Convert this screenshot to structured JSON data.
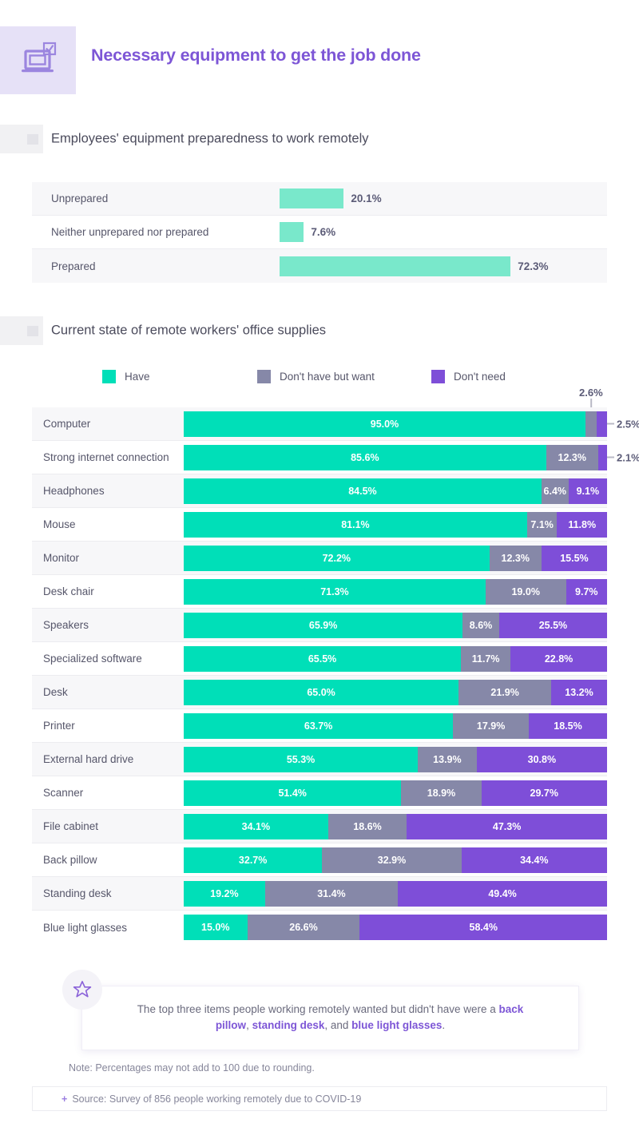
{
  "header": {
    "title": "Necessary equipment to get the job done",
    "icon": "laptop-check-icon",
    "icon_bg": "#e6e1f7",
    "title_color": "#7d56d6"
  },
  "colors": {
    "have": "#00dfb8",
    "have_light": "#79e8cb",
    "dont_have_but_want": "#8688a8",
    "dont_need": "#7e4ed8",
    "row_alt": "#f7f7f9",
    "text": "#56566a",
    "value_text": "#5b5b77"
  },
  "section1": {
    "marker": "section-marker",
    "title": "Employees' equipment preparedness to work remotely"
  },
  "section2": {
    "marker": "section-marker",
    "title": "Current state of remote workers' office supplies"
  },
  "legend": [
    {
      "label": "Have",
      "color": "#00dfb8"
    },
    {
      "label": "Don't have but want",
      "color": "#8688a8"
    },
    {
      "label": "Don't need",
      "color": "#7e4ed8"
    }
  ],
  "highlight": {
    "icon": "star-icon",
    "text_part1": "The top three items people working remotely wanted but didn't have were a ",
    "strong1": "back pillow",
    "text_part2": ", ",
    "strong2": "standing desk",
    "text_part3": ", and ",
    "strong3": "blue light glasses",
    "text_part4": "."
  },
  "footer": {
    "note": "Note: Percentages may not add to 100 due to rounding.",
    "source_plus": "+",
    "source": "Source: Survey of 856 people working remotely due to COVID-19"
  },
  "chart_data": [
    {
      "type": "bar",
      "title": "Employees' equipment preparedness to work remotely",
      "xlabel": "",
      "ylabel": "",
      "xlim": [
        0,
        100
      ],
      "grid": false,
      "legend_position": "none",
      "categories": [
        "Unprepared",
        "Neither unprepared nor prepared",
        "Prepared"
      ],
      "values": [
        20.1,
        7.6,
        72.3
      ],
      "value_labels": [
        "20.1%",
        "7.6%",
        "72.3%"
      ],
      "bar_color": "#79e8cb"
    },
    {
      "type": "bar",
      "subtype": "stacked-horizontal-100",
      "title": "Current state of remote workers' office supplies",
      "xlabel": "",
      "ylabel": "",
      "xlim": [
        0,
        100
      ],
      "grid": false,
      "legend_position": "top",
      "categories": [
        "Computer",
        "Strong internet connection",
        "Headphones",
        "Mouse",
        "Monitor",
        "Desk chair",
        "Speakers",
        "Specialized software",
        "Desk",
        "Printer",
        "External hard drive",
        "Scanner",
        "File cabinet",
        "Back pillow",
        "Standing desk",
        "Blue light glasses"
      ],
      "series": [
        {
          "name": "Have",
          "color": "#00dfb8",
          "values": [
            95.0,
            85.6,
            84.5,
            81.1,
            72.2,
            71.3,
            65.9,
            65.5,
            65.0,
            63.7,
            55.3,
            51.4,
            34.1,
            32.7,
            19.2,
            15.0
          ]
        },
        {
          "name": "Don't have but want",
          "color": "#8688a8",
          "values": [
            2.6,
            12.3,
            6.4,
            7.1,
            12.3,
            19.0,
            8.6,
            11.7,
            21.9,
            17.9,
            13.9,
            18.9,
            18.6,
            32.9,
            31.4,
            26.6
          ]
        },
        {
          "name": "Don't need",
          "color": "#7e4ed8",
          "values": [
            2.5,
            2.1,
            9.1,
            11.8,
            15.5,
            9.7,
            25.5,
            22.8,
            13.2,
            18.5,
            30.8,
            29.7,
            47.3,
            34.4,
            49.4,
            58.4
          ]
        }
      ]
    }
  ],
  "simple_rows": [
    {
      "label": "Unprepared",
      "value": 20.1,
      "value_label": "20.1%"
    },
    {
      "label": "Neither unprepared nor prepared",
      "value": 7.6,
      "value_label": "7.6%"
    },
    {
      "label": "Prepared",
      "value": 72.3,
      "value_label": "72.3%"
    }
  ],
  "stacked_rows": [
    {
      "label": "Computer",
      "have": 95.0,
      "want": 2.6,
      "dont": 2.5,
      "have_label": "95.0%",
      "want_label": "2.6%",
      "dont_label": "2.5%",
      "want_outside": "top",
      "dont_outside": "right"
    },
    {
      "label": "Strong internet connection",
      "have": 85.6,
      "want": 12.3,
      "dont": 2.1,
      "have_label": "85.6%",
      "want_label": "12.3%",
      "dont_label": "2.1%",
      "want_outside": "none",
      "dont_outside": "right"
    },
    {
      "label": "Headphones",
      "have": 84.5,
      "want": 6.4,
      "dont": 9.1,
      "have_label": "84.5%",
      "want_label": "6.4%",
      "dont_label": "9.1%",
      "want_outside": "none",
      "dont_outside": "none"
    },
    {
      "label": "Mouse",
      "have": 81.1,
      "want": 7.1,
      "dont": 11.8,
      "have_label": "81.1%",
      "want_label": "7.1%",
      "dont_label": "11.8%",
      "want_outside": "none",
      "dont_outside": "none"
    },
    {
      "label": "Monitor",
      "have": 72.2,
      "want": 12.3,
      "dont": 15.5,
      "have_label": "72.2%",
      "want_label": "12.3%",
      "dont_label": "15.5%",
      "want_outside": "none",
      "dont_outside": "none"
    },
    {
      "label": "Desk chair",
      "have": 71.3,
      "want": 19.0,
      "dont": 9.7,
      "have_label": "71.3%",
      "want_label": "19.0%",
      "dont_label": "9.7%",
      "want_outside": "none",
      "dont_outside": "none"
    },
    {
      "label": "Speakers",
      "have": 65.9,
      "want": 8.6,
      "dont": 25.5,
      "have_label": "65.9%",
      "want_label": "8.6%",
      "dont_label": "25.5%",
      "want_outside": "none",
      "dont_outside": "none"
    },
    {
      "label": "Specialized software",
      "have": 65.5,
      "want": 11.7,
      "dont": 22.8,
      "have_label": "65.5%",
      "want_label": "11.7%",
      "dont_label": "22.8%",
      "want_outside": "none",
      "dont_outside": "none"
    },
    {
      "label": "Desk",
      "have": 65.0,
      "want": 21.9,
      "dont": 13.2,
      "have_label": "65.0%",
      "want_label": "21.9%",
      "dont_label": "13.2%",
      "want_outside": "none",
      "dont_outside": "none"
    },
    {
      "label": "Printer",
      "have": 63.7,
      "want": 17.9,
      "dont": 18.5,
      "have_label": "63.7%",
      "want_label": "17.9%",
      "dont_label": "18.5%",
      "want_outside": "none",
      "dont_outside": "none"
    },
    {
      "label": "External hard drive",
      "have": 55.3,
      "want": 13.9,
      "dont": 30.8,
      "have_label": "55.3%",
      "want_label": "13.9%",
      "dont_label": "30.8%",
      "want_outside": "none",
      "dont_outside": "none"
    },
    {
      "label": "Scanner",
      "have": 51.4,
      "want": 18.9,
      "dont": 29.7,
      "have_label": "51.4%",
      "want_label": "18.9%",
      "dont_label": "29.7%",
      "want_outside": "none",
      "dont_outside": "none"
    },
    {
      "label": "File cabinet",
      "have": 34.1,
      "want": 18.6,
      "dont": 47.3,
      "have_label": "34.1%",
      "want_label": "18.6%",
      "dont_label": "47.3%",
      "want_outside": "none",
      "dont_outside": "none"
    },
    {
      "label": "Back pillow",
      "have": 32.7,
      "want": 32.9,
      "dont": 34.4,
      "have_label": "32.7%",
      "want_label": "32.9%",
      "dont_label": "34.4%",
      "want_outside": "none",
      "dont_outside": "none"
    },
    {
      "label": "Standing desk",
      "have": 19.2,
      "want": 31.4,
      "dont": 49.4,
      "have_label": "19.2%",
      "want_label": "31.4%",
      "dont_label": "49.4%",
      "want_outside": "none",
      "dont_outside": "none"
    },
    {
      "label": "Blue light glasses",
      "have": 15.0,
      "want": 26.6,
      "dont": 58.4,
      "have_label": "15.0%",
      "want_label": "26.6%",
      "dont_label": "58.4%",
      "want_outside": "none",
      "dont_outside": "none"
    }
  ]
}
